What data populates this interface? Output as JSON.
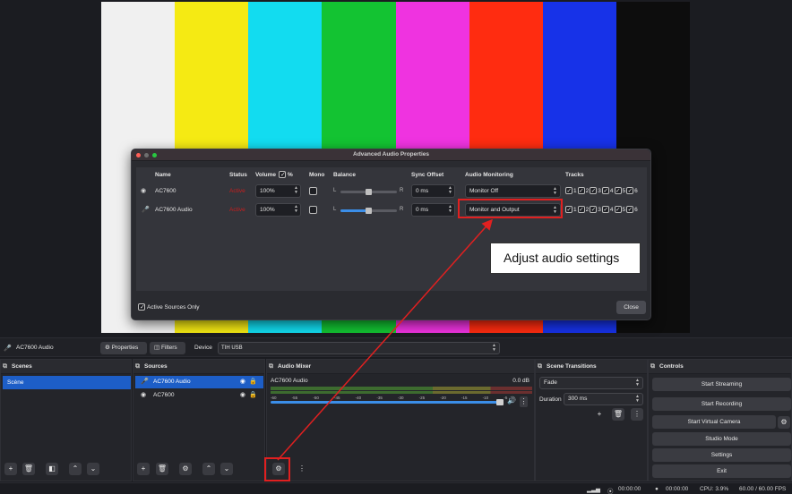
{
  "colors": {
    "bars": [
      "#f0f0f0",
      "#f5ea13",
      "#12dcf0",
      "#13c332",
      "#ef33e0",
      "#ff2c10",
      "#1732e8",
      "#0d0d0d"
    ],
    "accent": "#1d5ec7",
    "annotation": "#e02020"
  },
  "dialog": {
    "title": "Advanced Audio Properties",
    "headers": {
      "name": "Name",
      "status": "Status",
      "volume": "Volume",
      "volume_unit": "%",
      "mono": "Mono",
      "balance": "Balance",
      "sync_offset": "Sync Offset",
      "audio_monitoring": "Audio Monitoring",
      "tracks": "Tracks"
    },
    "rows": [
      {
        "icon": "camera-icon",
        "name": "AC7600",
        "status": "Active",
        "volume": "100%",
        "mono": false,
        "balance_left": "L",
        "balance_right": "R",
        "balance_fraction": 0.5,
        "sync_offset": "0 ms",
        "monitoring": "Monitor Off",
        "tracks": [
          "1",
          "2",
          "3",
          "4",
          "5",
          "6"
        ]
      },
      {
        "icon": "microphone-icon",
        "name": "AC7600 Audio",
        "status": "Active",
        "volume": "100%",
        "mono": false,
        "balance_left": "L",
        "balance_right": "R",
        "balance_fraction": 0.5,
        "sync_offset": "0 ms",
        "monitoring": "Monitor and Output",
        "tracks": [
          "1",
          "2",
          "3",
          "4",
          "5",
          "6"
        ]
      }
    ],
    "active_sources_only": "Active Sources Only",
    "close": "Close"
  },
  "callout": "Adjust audio settings",
  "source_toolbar": {
    "source_name": "AC7600 Audio",
    "properties": "Properties",
    "filters": "Filters",
    "device_label": "Device",
    "device_value": "TIH  USB"
  },
  "scenes": {
    "title": "Scenes",
    "items": [
      "Scène"
    ]
  },
  "sources": {
    "title": "Sources",
    "items": [
      "AC7600 Audio",
      "AC7600"
    ]
  },
  "mixer": {
    "title": "Audio Mixer",
    "channel": "AC7600 Audio",
    "db": "0.0 dB",
    "scale": [
      "-60",
      "-55",
      "-50",
      "-45",
      "-40",
      "-35",
      "-30",
      "-25",
      "-20",
      "-15",
      "-10",
      "-5",
      "0"
    ]
  },
  "transitions": {
    "title": "Scene Transitions",
    "type": "Fade",
    "duration_label": "Duration",
    "duration": "300 ms"
  },
  "controls": {
    "title": "Controls",
    "start_streaming": "Start Streaming",
    "start_recording": "Start Recording",
    "start_virtual_camera": "Start Virtual Camera",
    "studio_mode": "Studio Mode",
    "settings": "Settings",
    "exit": "Exit"
  },
  "status": {
    "stream_time": "00:00:00",
    "rec_time": "00:00:00",
    "cpu": "CPU: 3.9%",
    "fps": "60.00 / 60.00 FPS"
  }
}
